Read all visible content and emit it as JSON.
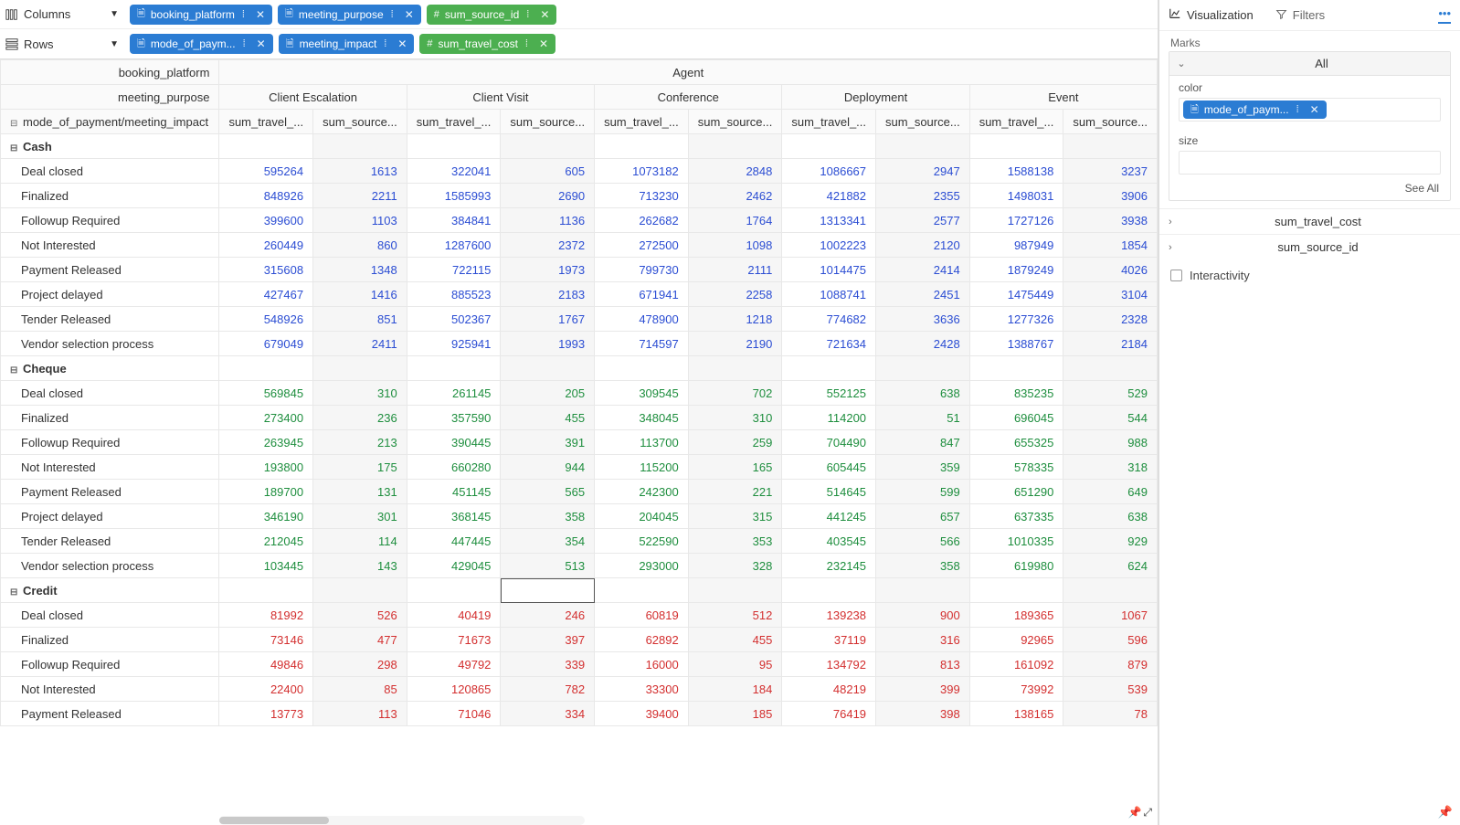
{
  "shelves": {
    "columns_label": "Columns",
    "rows_label": "Rows",
    "columns": [
      {
        "label": "booking_platform",
        "color": "blue",
        "icon": "doc"
      },
      {
        "label": "meeting_purpose",
        "color": "blue",
        "icon": "doc"
      },
      {
        "label": "sum_source_id",
        "color": "green",
        "icon": "hash"
      }
    ],
    "rows": [
      {
        "label": "mode_of_paym...",
        "color": "blue",
        "icon": "doc"
      },
      {
        "label": "meeting_impact",
        "color": "blue",
        "icon": "doc"
      },
      {
        "label": "sum_travel_cost",
        "color": "green",
        "icon": "hash"
      }
    ]
  },
  "grid": {
    "top_header_left": "booking_platform",
    "top_header_span": "Agent",
    "second_header_left": "meeting_purpose",
    "purposes": [
      "Client Escalation",
      "Client Visit",
      "Conference",
      "Deployment",
      "Event"
    ],
    "third_header_left": "mode_of_payment/meeting_impact",
    "measure_labels": [
      "sum_travel_...",
      "sum_source..."
    ],
    "groups": [
      {
        "name": "Cash",
        "color": "c-blue",
        "rows": [
          {
            "label": "Deal closed",
            "vals": [
              595264,
              1613,
              322041,
              605,
              1073182,
              2848,
              1086667,
              2947,
              1588138,
              3237
            ]
          },
          {
            "label": "Finalized",
            "vals": [
              848926,
              2211,
              1585993,
              2690,
              713230,
              2462,
              421882,
              2355,
              1498031,
              3906
            ]
          },
          {
            "label": "Followup Required",
            "vals": [
              399600,
              1103,
              384841,
              1136,
              262682,
              1764,
              1313341,
              2577,
              1727126,
              3938
            ]
          },
          {
            "label": "Not Interested",
            "vals": [
              260449,
              860,
              1287600,
              2372,
              272500,
              1098,
              1002223,
              2120,
              987949,
              1854
            ]
          },
          {
            "label": "Payment Released",
            "vals": [
              315608,
              1348,
              722115,
              1973,
              799730,
              2111,
              1014475,
              2414,
              1879249,
              4026
            ]
          },
          {
            "label": "Project delayed",
            "vals": [
              427467,
              1416,
              885523,
              2183,
              671941,
              2258,
              1088741,
              2451,
              1475449,
              3104
            ]
          },
          {
            "label": "Tender Released",
            "vals": [
              548926,
              851,
              502367,
              1767,
              478900,
              1218,
              774682,
              3636,
              1277326,
              2328
            ]
          },
          {
            "label": "Vendor selection process",
            "vals": [
              679049,
              2411,
              925941,
              1993,
              714597,
              2190,
              721634,
              2428,
              1388767,
              2184
            ]
          }
        ]
      },
      {
        "name": "Cheque",
        "color": "c-green",
        "rows": [
          {
            "label": "Deal closed",
            "vals": [
              569845,
              310,
              261145,
              205,
              309545,
              702,
              552125,
              638,
              835235,
              529
            ]
          },
          {
            "label": "Finalized",
            "vals": [
              273400,
              236,
              357590,
              455,
              348045,
              310,
              114200,
              51,
              696045,
              544
            ]
          },
          {
            "label": "Followup Required",
            "vals": [
              263945,
              213,
              390445,
              391,
              113700,
              259,
              704490,
              847,
              655325,
              988
            ]
          },
          {
            "label": "Not Interested",
            "vals": [
              193800,
              175,
              660280,
              944,
              115200,
              165,
              605445,
              359,
              578335,
              318
            ]
          },
          {
            "label": "Payment Released",
            "vals": [
              189700,
              131,
              451145,
              565,
              242300,
              221,
              514645,
              599,
              651290,
              649
            ]
          },
          {
            "label": "Project delayed",
            "vals": [
              346190,
              301,
              368145,
              358,
              204045,
              315,
              441245,
              657,
              637335,
              638
            ]
          },
          {
            "label": "Tender Released",
            "vals": [
              212045,
              114,
              447445,
              354,
              522590,
              353,
              403545,
              566,
              1010335,
              929
            ]
          },
          {
            "label": "Vendor selection process",
            "vals": [
              103445,
              143,
              429045,
              513,
              293000,
              328,
              232145,
              358,
              619980,
              624
            ]
          }
        ]
      },
      {
        "name": "Credit",
        "color": "c-red",
        "rows": [
          {
            "label": "Deal closed",
            "vals": [
              81992,
              526,
              40419,
              246,
              60819,
              512,
              139238,
              900,
              189365,
              1067
            ]
          },
          {
            "label": "Finalized",
            "vals": [
              73146,
              477,
              71673,
              397,
              62892,
              455,
              37119,
              316,
              92965,
              596
            ]
          },
          {
            "label": "Followup Required",
            "vals": [
              49846,
              298,
              49792,
              339,
              16000,
              95,
              134792,
              813,
              161092,
              879
            ]
          },
          {
            "label": "Not Interested",
            "vals": [
              22400,
              85,
              120865,
              782,
              33300,
              184,
              48219,
              399,
              73992,
              539
            ]
          },
          {
            "label": "Payment Released",
            "vals": [
              13773,
              113,
              71046,
              334,
              39400,
              185,
              76419,
              398,
              138165,
              78
            ]
          }
        ]
      }
    ],
    "selected_cell": {
      "group": 2,
      "is_group_row": true,
      "col": 3
    }
  },
  "side": {
    "tab_viz": "Visualization",
    "tab_filters": "Filters",
    "marks_title": "Marks",
    "all_label": "All",
    "color_label": "color",
    "color_pill": "mode_of_paym...",
    "size_label": "size",
    "see_all": "See All",
    "measures": [
      "sum_travel_cost",
      "sum_source_id"
    ],
    "interactivity": "Interactivity"
  }
}
